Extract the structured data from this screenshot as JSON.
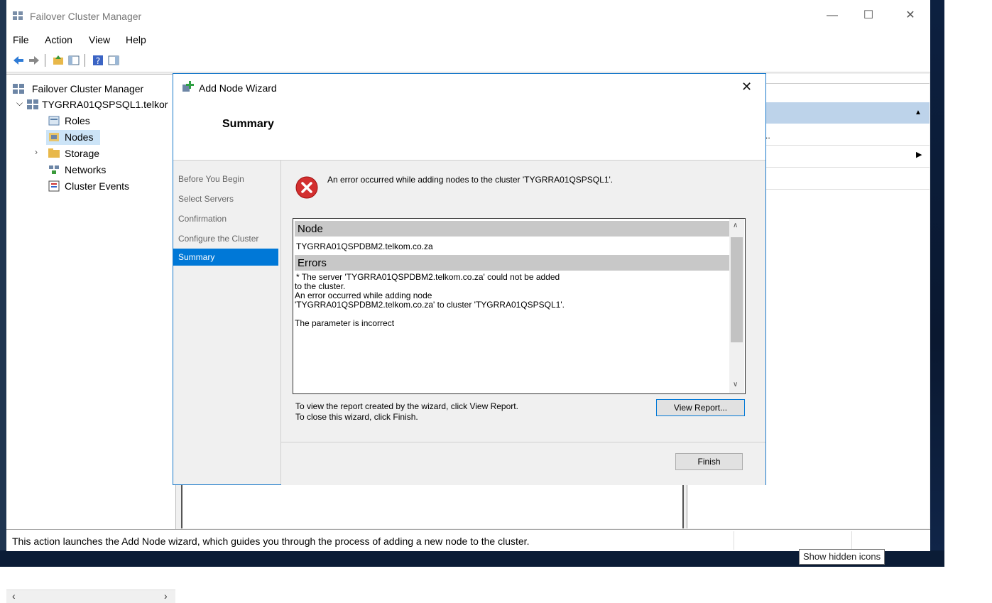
{
  "window": {
    "title": "Failover Cluster Manager",
    "controls": {
      "minimize": "—",
      "maximize": "☐",
      "close": "✕"
    }
  },
  "menu": [
    "File",
    "Action",
    "View",
    "Help"
  ],
  "tree": {
    "root": "Failover Cluster Manager",
    "cluster": "TYGRRA01QSPSQL1.telkor",
    "items": [
      "Roles",
      "Nodes",
      "Storage",
      "Networks",
      "Cluster Events"
    ],
    "selected": "Nodes"
  },
  "dialog": {
    "title": "Add Node Wizard",
    "heading": "Summary",
    "close": "✕",
    "steps": [
      "Before You Begin",
      "Select Servers",
      "Confirmation",
      "Configure the Cluster",
      "Summary"
    ],
    "active_step": "Summary",
    "error_message": "An error occurred while adding nodes to the cluster 'TYGRRA01QSPSQL1'.",
    "node_header": "Node",
    "node_value": "TYGRRA01QSPDBM2.telkom.co.za",
    "errors_header": "Errors",
    "error_lines": [
      " * The server 'TYGRRA01QSPDBM2.telkom.co.za' could not be added",
      "to the cluster.",
      "An error occurred while adding node",
      "'TYGRRA01QSPDBM2.telkom.co.za' to cluster 'TYGRRA01QSPSQL1'.",
      "",
      "The parameter is incorrect"
    ],
    "hint_view": "To view the report created by the wizard, click View Report.",
    "hint_close": "To close this wizard, click Finish.",
    "view_report_label": "View Report...",
    "finish_label": "Finish"
  },
  "actions": {
    "more": ".."
  },
  "status": "This action launches the Add Node wizard, which guides you through the process of adding a new node to the cluster.",
  "tooltip": "Show hidden icons"
}
